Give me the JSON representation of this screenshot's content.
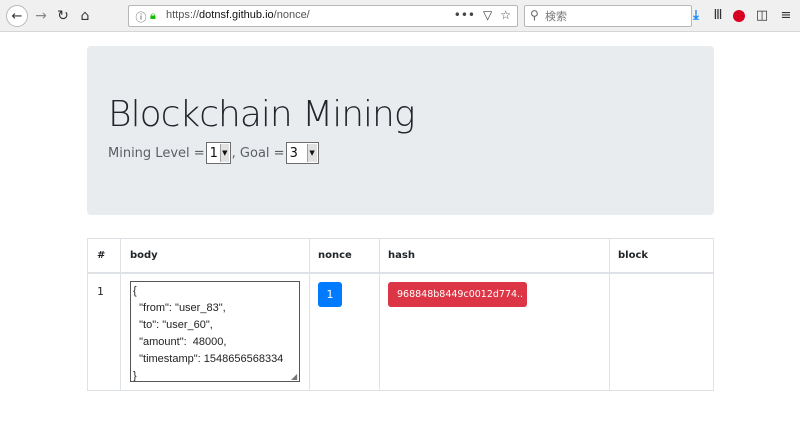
{
  "browser": {
    "url_prefix": "https://",
    "url_host": "dotnsf.github.io",
    "url_path": "/nonce/",
    "search_placeholder": "検索",
    "icons": {
      "back": "arrow-left-icon",
      "forward": "arrow-right-icon",
      "reload": "reload-icon",
      "home": "home-icon",
      "info": "info-icon",
      "lock": "lock-icon",
      "more": "ellipsis-icon",
      "pocket": "pocket-icon",
      "bookmark": "star-icon",
      "search": "search-icon",
      "download": "download-icon",
      "library": "library-icon",
      "extension": "extension-icon",
      "sidebar": "sidebar-icon",
      "menu": "hamburger-menu-icon"
    },
    "colors": {
      "lock": "#12bc00",
      "download": "#0a84ff",
      "extension": "#d70022"
    }
  },
  "header": {
    "title": "Blockchain Mining",
    "level_label": "Mining Level =",
    "level_value": "1",
    "goal_label": ", Goal =",
    "goal_value": "3"
  },
  "table": {
    "columns": [
      "#",
      "body",
      "nonce",
      "hash",
      "block"
    ],
    "rows": [
      {
        "index": "1",
        "body": "{\n  \"from\": \"user_83\",\n  \"to\": \"user_60\",\n  \"amount\":  48000,\n  \"timestamp\": 1548656568334\n}",
        "nonce": "1",
        "hash": "968848b8449c0012d774..",
        "block": ""
      }
    ]
  },
  "colors": {
    "jumbotron_bg": "#e9ecef",
    "nonce_badge": "#007bff",
    "hash_badge": "#dc3545"
  }
}
